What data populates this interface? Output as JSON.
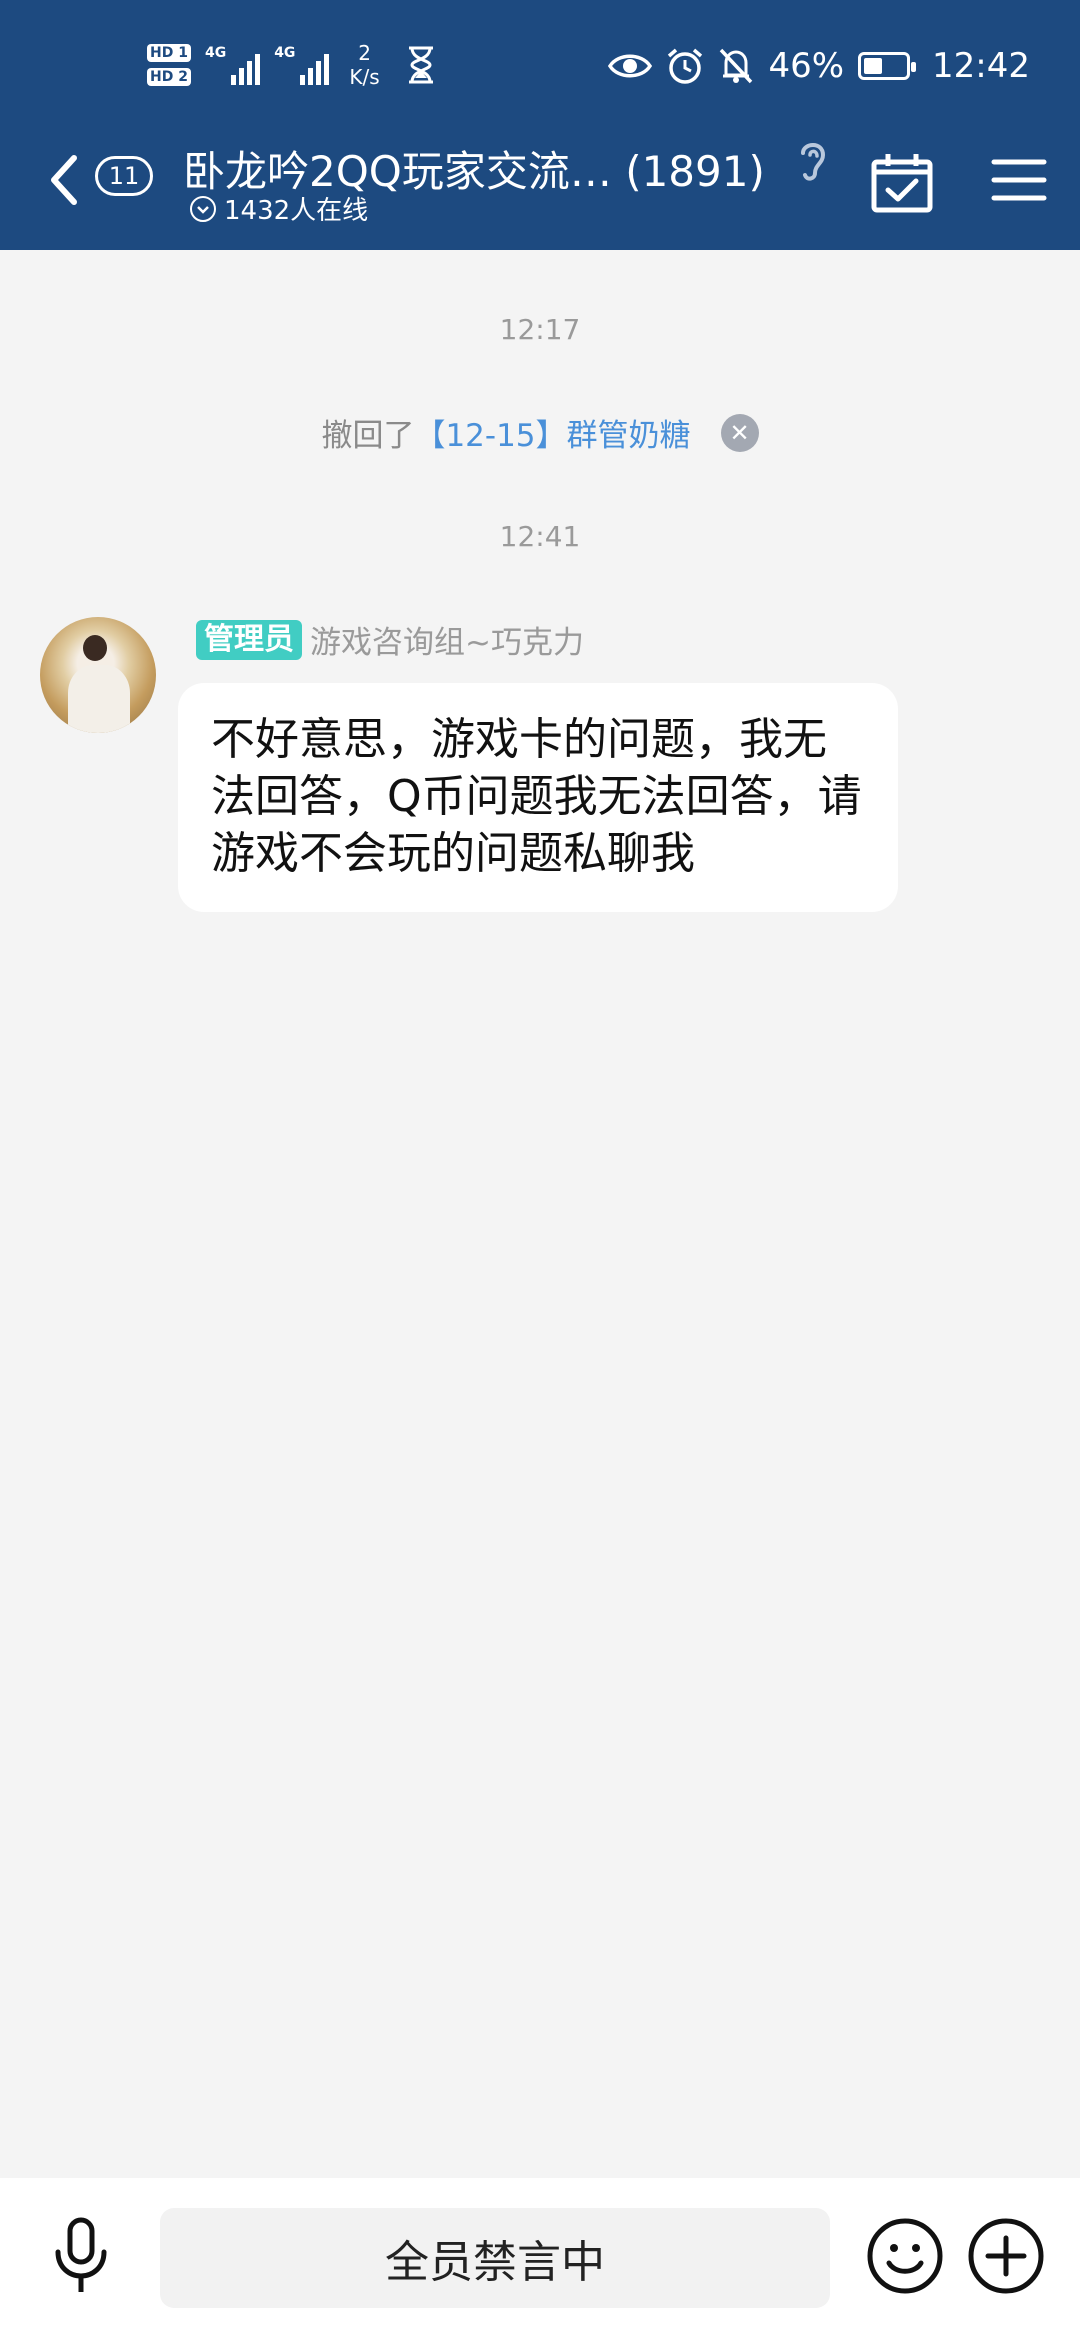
{
  "status_bar": {
    "sim1": "HD 1",
    "sim2": "HD 2",
    "net1": "4G",
    "net2": "4G",
    "speed_value": "2",
    "speed_unit": "K/s",
    "battery_text": "46%",
    "battery_level": 0.46,
    "clock": "12:42",
    "icons": [
      "hourglass-icon",
      "eye-icon",
      "alarm-icon",
      "mute-icon",
      "battery-icon"
    ]
  },
  "header": {
    "unread_count": "11",
    "title": "卧龙吟2QQ玩家交流… (1891)",
    "online_text": "1432人在线",
    "icons": [
      "back-icon",
      "ear-icon",
      "calendar-check-icon",
      "menu-icon"
    ]
  },
  "chat": {
    "time1": "12:17",
    "recall_prefix": "撤回了",
    "recall_link": "【12-15】群管奶糖",
    "recall_close": "✕",
    "time2": "12:41",
    "message": {
      "role": "管理员",
      "sender": "游戏咨询组~巧克力",
      "text": "不好意思，游戏卡的问题，我无法回答，Q币问题我无法回答，请游戏不会玩的问题私聊我"
    }
  },
  "bottom": {
    "input_placeholder": "全员禁言中",
    "icons": [
      "microphone-icon",
      "emoji-icon",
      "plus-icon"
    ]
  },
  "colors": {
    "header_bg": "#1d4a80",
    "role_badge": "#41cdc3",
    "link": "#4a90d9"
  }
}
